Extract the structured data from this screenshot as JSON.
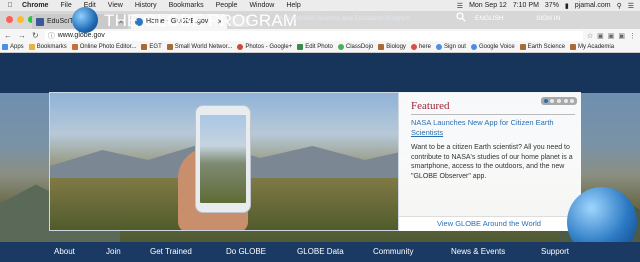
{
  "menubar": {
    "items": [
      "Chrome",
      "File",
      "Edit",
      "View",
      "History",
      "Bookmarks",
      "People",
      "Window",
      "Help"
    ],
    "date": "Mon Sep 12",
    "time": "7:10 PM",
    "battery": "37%",
    "user": "pjamal.com"
  },
  "tabs": [
    {
      "title": "EduSciTech",
      "active": false
    },
    {
      "title": "Home - GLOBE.gov",
      "active": true
    }
  ],
  "address": {
    "url": "www.globe.gov"
  },
  "bookmarks": [
    "Apps",
    "Bookmarks",
    "Online Photo Editor...",
    "EGT",
    "Small World Networ...",
    "Photos - Google+",
    "Edit Photo",
    "ClassDojo",
    "Biology",
    "here",
    "Sign out",
    "Google Voice",
    "Earth Science",
    "My Academia"
  ],
  "site": {
    "logo_text": "THE GLOBE PROGRAM",
    "tagline": "A Worldwide Science and Education Program",
    "language": "ENGLISH",
    "signin": "SIGN IN"
  },
  "featured": {
    "heading": "Featured",
    "link_line1": "NASA Launches New App for Citizen Earth",
    "link_line2": "Scientists",
    "body": "Want to be a citizen Earth scientist? All you need to contribute to NASA's studies of our home planet is a smartphone, access to the outdoors, and the new \"GLOBE Observer\" app.",
    "view_link": "View GLOBE Around the World"
  },
  "nav": [
    "About",
    "Join",
    "Get Trained",
    "Do GLOBE",
    "GLOBE Data",
    "Community",
    "News & Events",
    "Support"
  ],
  "colors": {
    "header_bg": "#17345a",
    "accent_red": "#9b2333",
    "link_blue": "#2b6fb3"
  }
}
